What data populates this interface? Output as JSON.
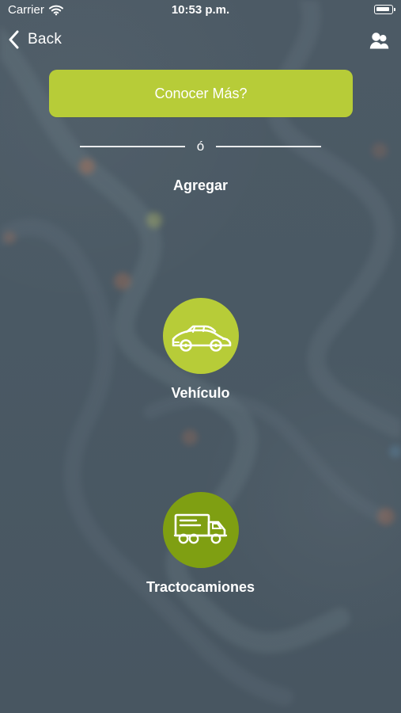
{
  "status_bar": {
    "carrier": "Carrier",
    "time": "10:53 p.m."
  },
  "nav": {
    "back_label": "Back"
  },
  "actions": {
    "learn_more": "Conocer Más?"
  },
  "divider": {
    "text": "ó"
  },
  "sections": {
    "add_label": "Agregar"
  },
  "options": [
    {
      "label": "Vehículo",
      "icon": "car-icon"
    },
    {
      "label": "Tractocamiones",
      "icon": "truck-icon"
    }
  ],
  "icons": {
    "wifi": "wifi-icon",
    "battery": "battery-icon",
    "back": "chevron-left-icon",
    "users": "users-icon"
  },
  "colors": {
    "background": "#4b5a66",
    "primary_button": "#b7cc38",
    "vehicle_circle": "#b7cc38",
    "truck_circle": "#7f9f12",
    "text": "#ffffff"
  }
}
